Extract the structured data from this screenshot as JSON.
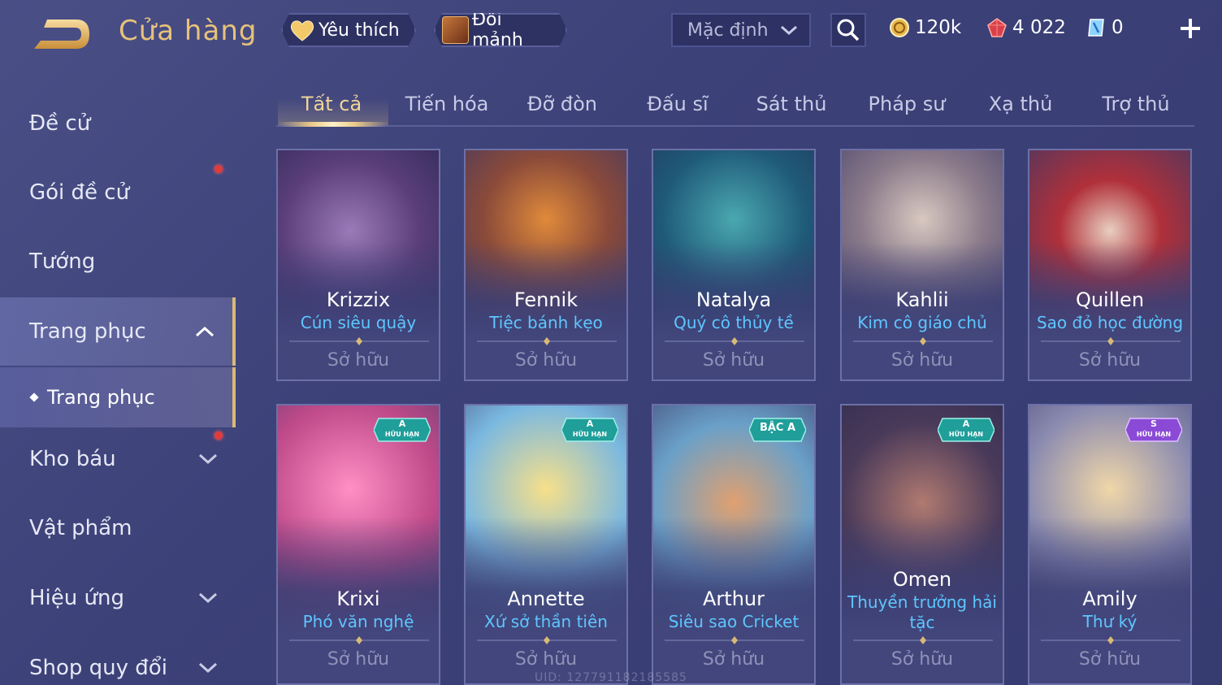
{
  "header": {
    "title": "Cửa hàng",
    "favorite_label": "Yêu thích",
    "exchange_label": "Đổi mảnh",
    "sort_value": "Mặc định",
    "currencies": [
      {
        "name": "gold",
        "value": "120k",
        "icon": "gold-coin-icon"
      },
      {
        "name": "ruby",
        "value": "4 022",
        "icon": "ruby-gem-icon"
      },
      {
        "name": "voucher",
        "value": "0",
        "icon": "voucher-icon"
      }
    ]
  },
  "sidebar": {
    "items": [
      {
        "label": "Đề cử"
      },
      {
        "label": "Gói đề cử"
      },
      {
        "label": "Tướng"
      },
      {
        "label": "Trang phục"
      },
      {
        "label": "Trang phục"
      },
      {
        "label": "Kho báu"
      },
      {
        "label": "Vật phẩm"
      },
      {
        "label": "Hiệu ứng"
      },
      {
        "label": "Shop quy đổi"
      }
    ]
  },
  "tabs": [
    "Tất cả",
    "Tiến hóa",
    "Đỡ đòn",
    "Đấu sĩ",
    "Sát thủ",
    "Pháp sư",
    "Xạ thủ",
    "Trợ thủ"
  ],
  "cards": [
    {
      "hero": "Krizzix",
      "skin": "Cún siêu quậy",
      "status": "Sở hữu",
      "tier": ""
    },
    {
      "hero": "Fennik",
      "skin": "Tiệc bánh kẹo",
      "status": "Sở hữu",
      "tier": ""
    },
    {
      "hero": "Natalya",
      "skin": "Quý cô thủy tề",
      "status": "Sở hữu",
      "tier": ""
    },
    {
      "hero": "Kahlii",
      "skin": "Kim cô giáo chủ",
      "status": "Sở hữu",
      "tier": ""
    },
    {
      "hero": "Quillen",
      "skin": "Sao đỏ học đường",
      "status": "Sở hữu",
      "tier": ""
    },
    {
      "hero": "Krixi",
      "skin": "Phó văn nghệ",
      "status": "Sở hữu",
      "tier": "A",
      "tier_sub": "HỮU HẠN"
    },
    {
      "hero": "Annette",
      "skin": "Xứ sở thần tiên",
      "status": "Sở hữu",
      "tier": "A",
      "tier_sub": "HỮU HẠN"
    },
    {
      "hero": "Arthur",
      "skin": "Siêu sao Cricket",
      "status": "Sở hữu",
      "tier": "BẬC A",
      "tier_sub": ""
    },
    {
      "hero": "Omen",
      "skin": "Thuyền trưởng hải tặc",
      "status": "Sở hữu",
      "tier": "A",
      "tier_sub": "HỮU HẠN"
    },
    {
      "hero": "Amily",
      "skin": "Thư ký",
      "status": "Sở hữu",
      "tier": "S",
      "tier_sub": "HỮU HẠN"
    }
  ],
  "uid_text": "UID: 127791182185585",
  "colors": {
    "accent_gold": "#e8c27a",
    "skin_name": "#5ec6ff",
    "badge_teal": "#1f9e9a",
    "badge_purple": "#8a4ad6"
  }
}
